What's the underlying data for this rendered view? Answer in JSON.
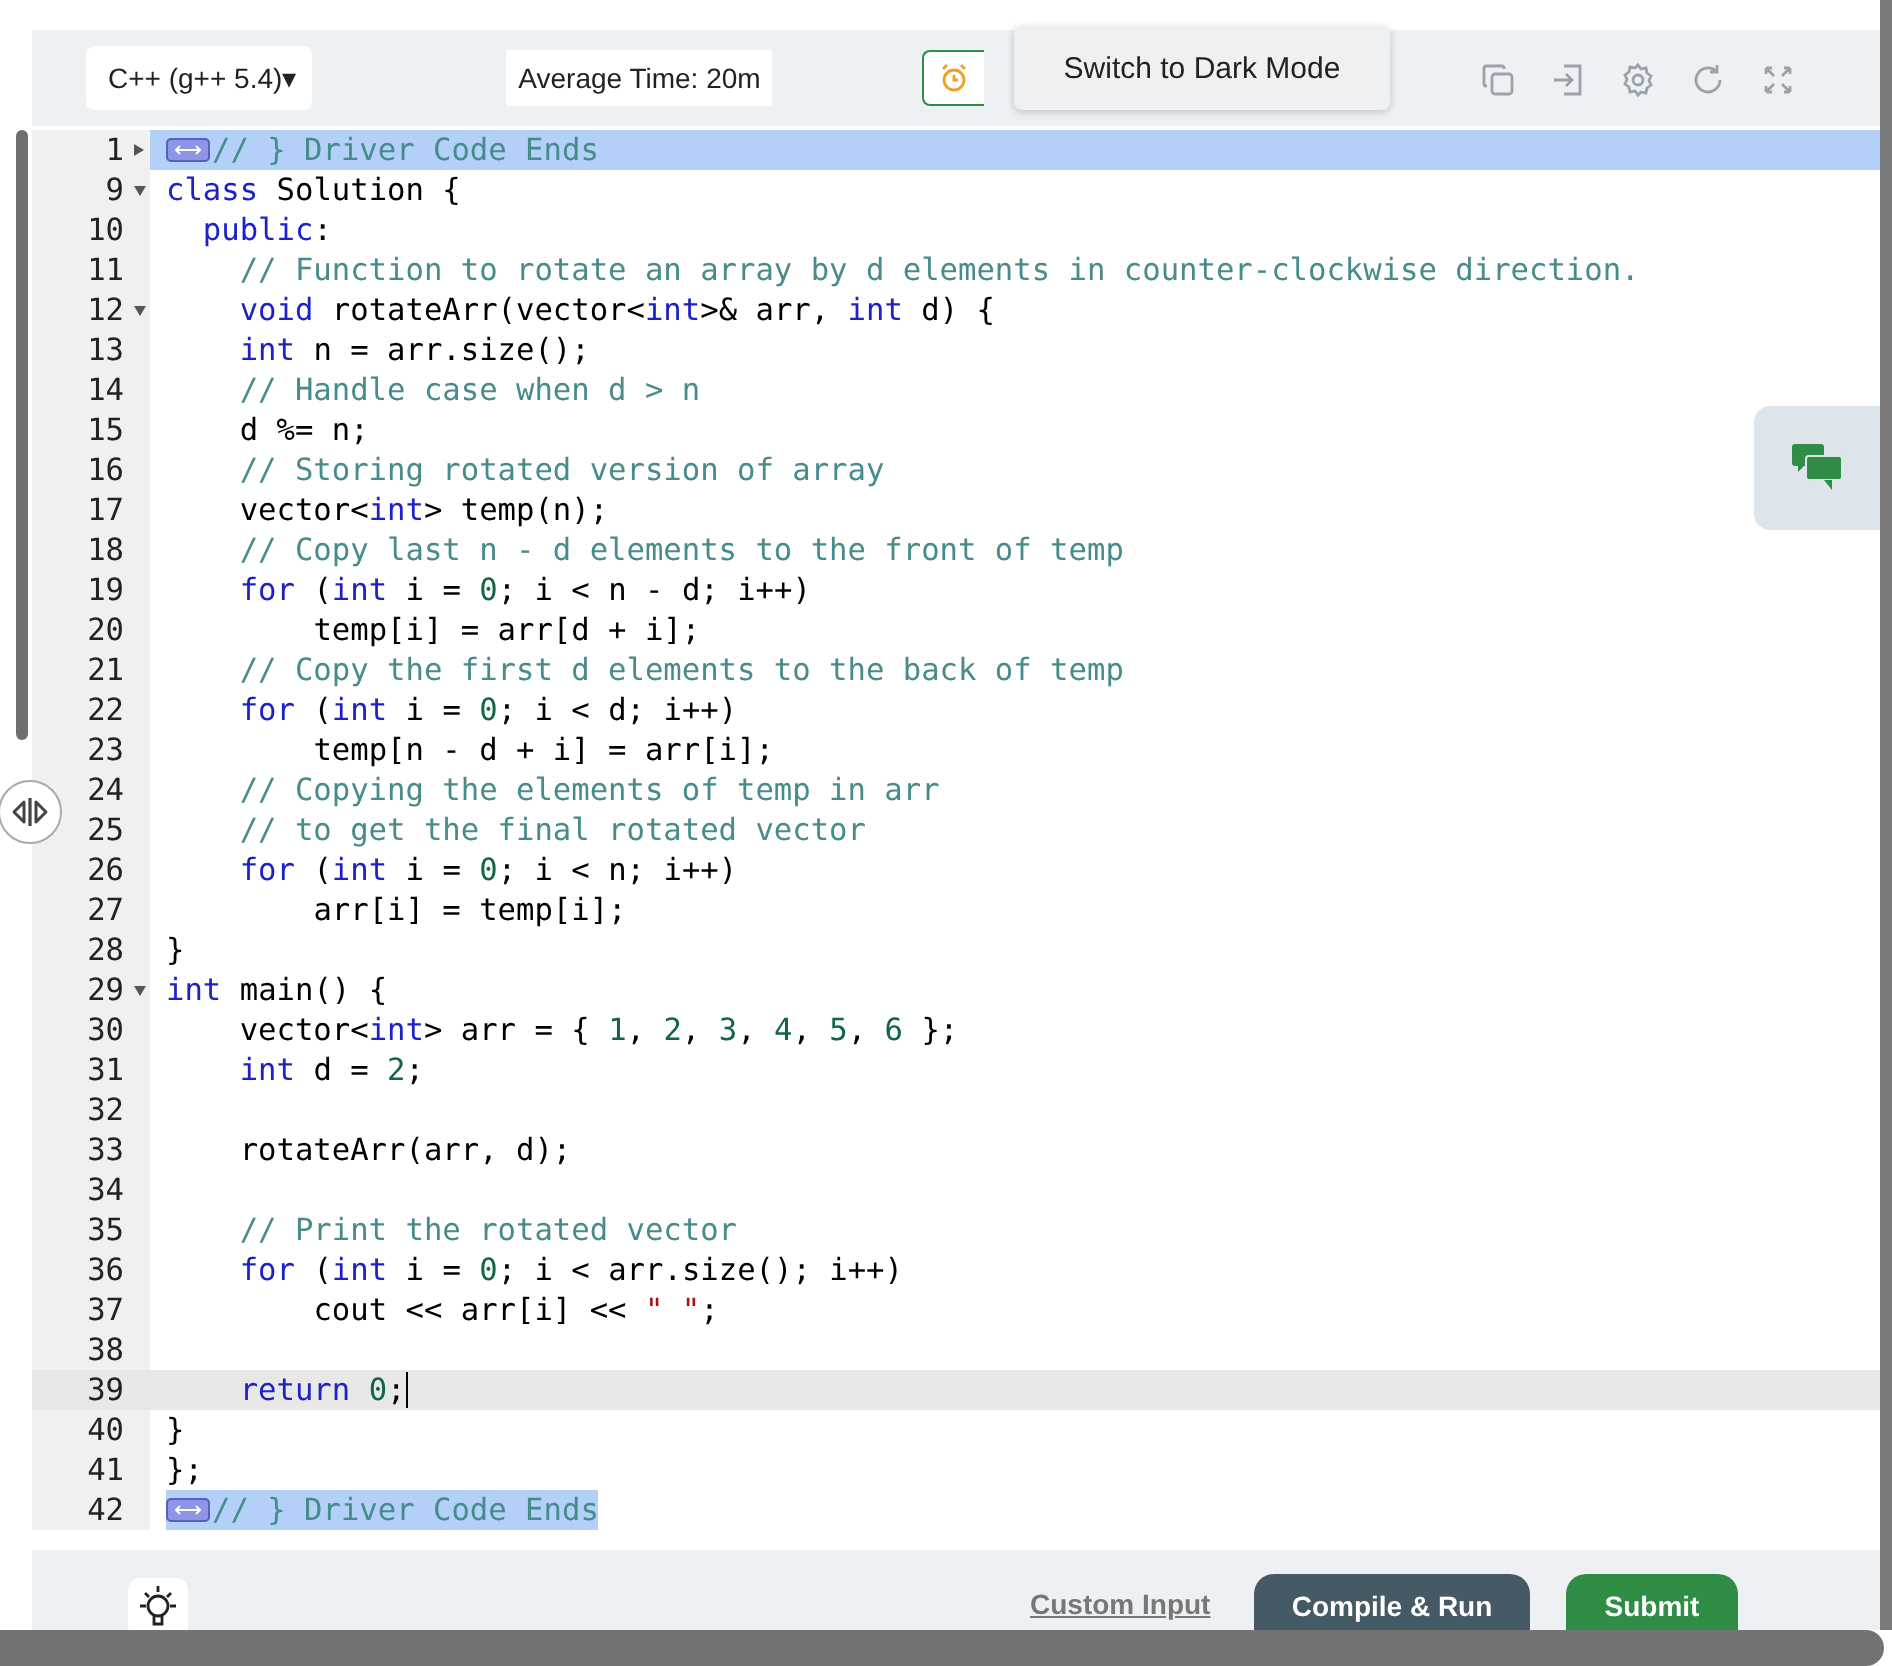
{
  "toolbar": {
    "language": "C++ (g++ 5.4)",
    "language_caret": "▾",
    "average_time": "Average Time: 20m",
    "tooltip": "Switch to Dark Mode"
  },
  "editor": {
    "lines": [
      {
        "number": "1",
        "expanded": false,
        "selected": true,
        "selection_to_line_end": true,
        "tokens": [
          {
            "kind": "widget"
          },
          {
            "kind": "comment",
            "text": "// } Driver Code Ends"
          }
        ]
      },
      {
        "number": "9",
        "expanded": true,
        "tokens": [
          {
            "kind": "keyword",
            "text": "class"
          },
          {
            "kind": "plain",
            "text": " Solution {"
          }
        ]
      },
      {
        "number": "10",
        "tokens": [
          {
            "kind": "keyword",
            "text": "  public"
          },
          {
            "kind": "plain",
            "text": ":"
          }
        ]
      },
      {
        "number": "11",
        "tokens": [
          {
            "kind": "comment",
            "text": "    // Function to rotate an array by d elements in counter-clockwise direction."
          }
        ]
      },
      {
        "number": "12",
        "expanded": true,
        "tokens": [
          {
            "kind": "keyword",
            "text": "    void"
          },
          {
            "kind": "plain",
            "text": " rotateArr(vector<"
          },
          {
            "kind": "keyword",
            "text": "int"
          },
          {
            "kind": "plain",
            "text": ">& arr, "
          },
          {
            "kind": "keyword",
            "text": "int"
          },
          {
            "kind": "plain",
            "text": " d) {"
          }
        ]
      },
      {
        "number": "13",
        "tokens": [
          {
            "kind": "keyword",
            "text": "    int"
          },
          {
            "kind": "plain",
            "text": " n = arr.size();"
          }
        ]
      },
      {
        "number": "14",
        "tokens": [
          {
            "kind": "comment",
            "text": "    // Handle case when d > n"
          }
        ]
      },
      {
        "number": "15",
        "tokens": [
          {
            "kind": "plain",
            "text": "    d %= n;"
          }
        ]
      },
      {
        "number": "16",
        "tokens": [
          {
            "kind": "comment",
            "text": "    // Storing rotated version of array"
          }
        ]
      },
      {
        "number": "17",
        "tokens": [
          {
            "kind": "plain",
            "text": "    vector<"
          },
          {
            "kind": "keyword",
            "text": "int"
          },
          {
            "kind": "plain",
            "text": "> temp(n);"
          }
        ]
      },
      {
        "number": "18",
        "tokens": [
          {
            "kind": "comment",
            "text": "    // Copy last n - d elements to the front of temp"
          }
        ]
      },
      {
        "number": "19",
        "tokens": [
          {
            "kind": "keyword",
            "text": "    for"
          },
          {
            "kind": "plain",
            "text": " ("
          },
          {
            "kind": "keyword",
            "text": "int"
          },
          {
            "kind": "plain",
            "text": " i = "
          },
          {
            "kind": "number",
            "text": "0"
          },
          {
            "kind": "plain",
            "text": "; i < n - d; i++)"
          }
        ]
      },
      {
        "number": "20",
        "tokens": [
          {
            "kind": "plain",
            "text": "        temp[i] = arr[d + i];"
          }
        ]
      },
      {
        "number": "21",
        "tokens": [
          {
            "kind": "comment",
            "text": "    // Copy the first d elements to the back of temp"
          }
        ]
      },
      {
        "number": "22",
        "tokens": [
          {
            "kind": "keyword",
            "text": "    for"
          },
          {
            "kind": "plain",
            "text": " ("
          },
          {
            "kind": "keyword",
            "text": "int"
          },
          {
            "kind": "plain",
            "text": " i = "
          },
          {
            "kind": "number",
            "text": "0"
          },
          {
            "kind": "plain",
            "text": "; i < d; i++)"
          }
        ]
      },
      {
        "number": "23",
        "tokens": [
          {
            "kind": "plain",
            "text": "        temp[n - d + i] = arr[i];"
          }
        ]
      },
      {
        "number": "24",
        "tokens": [
          {
            "kind": "comment",
            "text": "    // Copying the elements of temp in arr"
          }
        ]
      },
      {
        "number": "25",
        "tokens": [
          {
            "kind": "comment",
            "text": "    // to get the final rotated vector"
          }
        ]
      },
      {
        "number": "26",
        "tokens": [
          {
            "kind": "keyword",
            "text": "    for"
          },
          {
            "kind": "plain",
            "text": " ("
          },
          {
            "kind": "keyword",
            "text": "int"
          },
          {
            "kind": "plain",
            "text": " i = "
          },
          {
            "kind": "number",
            "text": "0"
          },
          {
            "kind": "plain",
            "text": "; i < n; i++)"
          }
        ]
      },
      {
        "number": "27",
        "tokens": [
          {
            "kind": "plain",
            "text": "        arr[i] = temp[i];"
          }
        ]
      },
      {
        "number": "28",
        "tokens": [
          {
            "kind": "plain",
            "text": "}"
          }
        ]
      },
      {
        "number": "29",
        "expanded": true,
        "tokens": [
          {
            "kind": "keyword",
            "text": "int"
          },
          {
            "kind": "plain",
            "text": " main() {"
          }
        ]
      },
      {
        "number": "30",
        "tokens": [
          {
            "kind": "plain",
            "text": "    vector<"
          },
          {
            "kind": "keyword",
            "text": "int"
          },
          {
            "kind": "plain",
            "text": "> arr = { "
          },
          {
            "kind": "number",
            "text": "1"
          },
          {
            "kind": "plain",
            "text": ", "
          },
          {
            "kind": "number",
            "text": "2"
          },
          {
            "kind": "plain",
            "text": ", "
          },
          {
            "kind": "number",
            "text": "3"
          },
          {
            "kind": "plain",
            "text": ", "
          },
          {
            "kind": "number",
            "text": "4"
          },
          {
            "kind": "plain",
            "text": ", "
          },
          {
            "kind": "number",
            "text": "5"
          },
          {
            "kind": "plain",
            "text": ", "
          },
          {
            "kind": "number",
            "text": "6"
          },
          {
            "kind": "plain",
            "text": " };"
          }
        ]
      },
      {
        "number": "31",
        "tokens": [
          {
            "kind": "keyword",
            "text": "    int"
          },
          {
            "kind": "plain",
            "text": " d = "
          },
          {
            "kind": "number",
            "text": "2"
          },
          {
            "kind": "plain",
            "text": ";"
          }
        ]
      },
      {
        "number": "32"
      },
      {
        "number": "33",
        "tokens": [
          {
            "kind": "plain",
            "text": "    rotateArr(arr, d);"
          }
        ]
      },
      {
        "number": "34"
      },
      {
        "number": "35",
        "tokens": [
          {
            "kind": "comment",
            "text": "    // Print the rotated vector"
          }
        ]
      },
      {
        "number": "36",
        "tokens": [
          {
            "kind": "keyword",
            "text": "    for"
          },
          {
            "kind": "plain",
            "text": " ("
          },
          {
            "kind": "keyword",
            "text": "int"
          },
          {
            "kind": "plain",
            "text": " i = "
          },
          {
            "kind": "number",
            "text": "0"
          },
          {
            "kind": "plain",
            "text": "; i < arr.size(); i++)"
          }
        ]
      },
      {
        "number": "37",
        "tokens": [
          {
            "kind": "plain",
            "text": "        cout << arr[i] << "
          },
          {
            "kind": "string",
            "text": "\" \""
          },
          {
            "kind": "plain",
            "text": ";"
          }
        ]
      },
      {
        "number": "38"
      },
      {
        "number": "39",
        "active": true,
        "tokens": [
          {
            "kind": "keyword",
            "text": "    return"
          },
          {
            "kind": "number",
            "text": " 0"
          },
          {
            "kind": "plain",
            "text": ";"
          }
        ]
      },
      {
        "number": "40",
        "tokens": [
          {
            "kind": "plain",
            "text": "}"
          }
        ]
      },
      {
        "number": "41",
        "tokens": [
          {
            "kind": "plain",
            "text": "};"
          }
        ]
      },
      {
        "number": "42",
        "selected": true,
        "selection_to_line_end": false,
        "tokens": [
          {
            "kind": "widget"
          },
          {
            "kind": "comment",
            "text": "// } Driver Code Ends"
          }
        ]
      }
    ]
  },
  "bottom_bar": {
    "custom_input": "Custom Input",
    "compile_button": "Compile & Run",
    "submit_button": "Submit"
  }
}
